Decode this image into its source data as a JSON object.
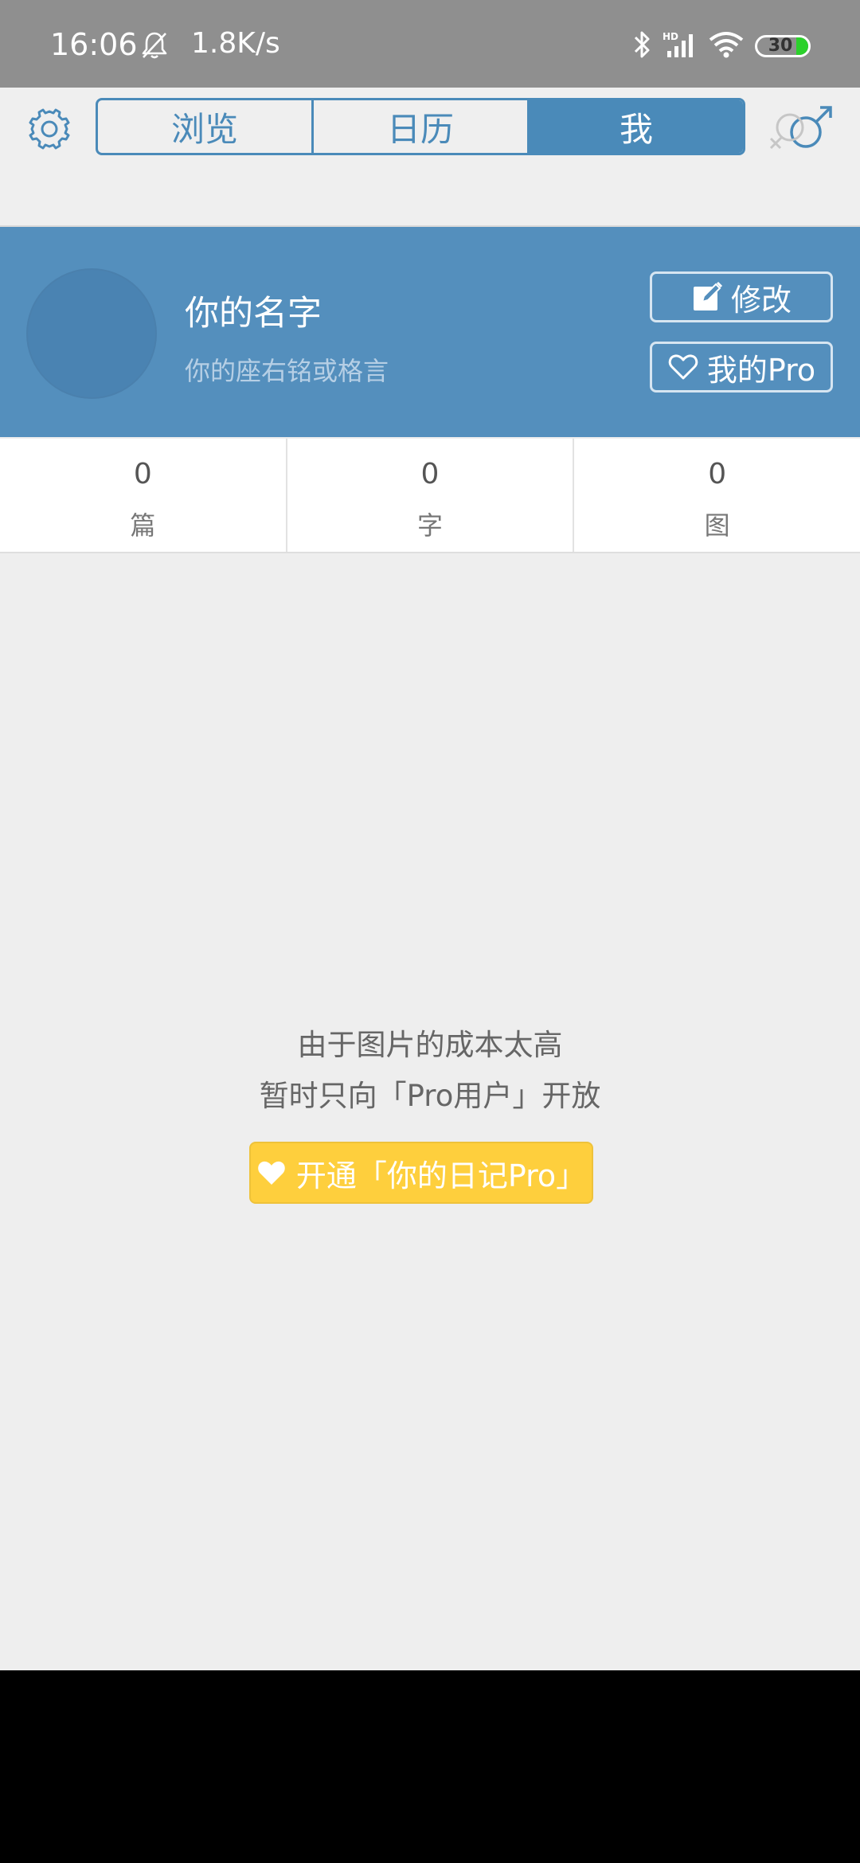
{
  "status_bar": {
    "time": "16:06",
    "net_speed": "1.8K/s",
    "battery": "30",
    "icons": [
      "bell-off-icon",
      "bluetooth-icon",
      "signal-icon",
      "wifi-icon",
      "battery-icon"
    ]
  },
  "top_bar": {
    "tabs": [
      {
        "label": "浏览",
        "active": false
      },
      {
        "label": "日历",
        "active": false
      },
      {
        "label": "我",
        "active": true
      }
    ],
    "left_icon": "gear-icon",
    "right_icon": "gender-icon",
    "accent_color": "#4a8ab9"
  },
  "profile": {
    "name": "你的名字",
    "motto": "你的座右铭或格言",
    "edit_label": "修改",
    "pro_label": "我的Pro",
    "background_color": "#548fbd"
  },
  "stats": [
    {
      "value": "0",
      "label": "篇"
    },
    {
      "value": "0",
      "label": "字"
    },
    {
      "value": "0",
      "label": "图"
    }
  ],
  "empty_state": {
    "line1": "由于图片的成本太高",
    "line2": "暂时只向「Pro用户」开放",
    "button_label": "开通「你的日记Pro」",
    "button_color": "#fecf3d"
  }
}
